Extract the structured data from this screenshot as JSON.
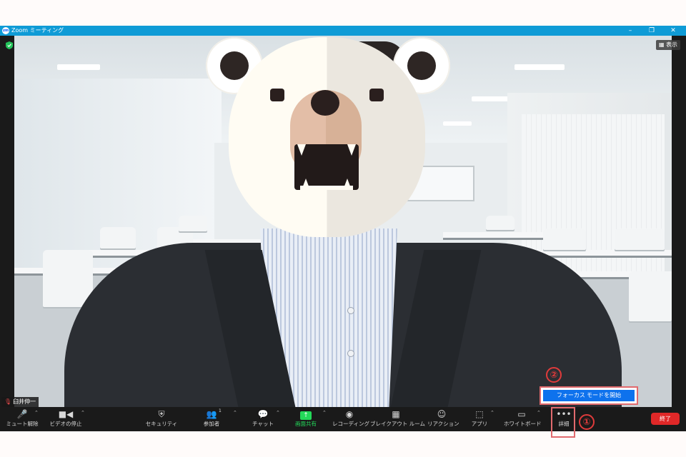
{
  "window": {
    "title": "Zoom ミーティング",
    "logo": "zoom",
    "controls": [
      "–",
      "❐",
      "✕"
    ]
  },
  "video": {
    "view_button": "表示",
    "participant_name": "臼井伸一",
    "participant_muted": true
  },
  "focus_popup": {
    "button_label": "フォーカス モードを開始"
  },
  "toolbar": {
    "mute_label": "ミュート解除",
    "video_label": "ビデオの停止",
    "security_label": "セキュリティ",
    "participants_label": "参加者",
    "participants_count": "1",
    "chat_label": "チャット",
    "share_label": "画面共有",
    "recording_label": "レコーディング",
    "breakout_label": "ブレイクアウト ルーム",
    "reactions_label": "リアクション",
    "apps_label": "アプリ",
    "whiteboard_label": "ホワイトボード",
    "more_label": "詳細",
    "end_label": "終了"
  },
  "annotations": {
    "step1": "①",
    "step2": "②",
    "color": "#e03b3b"
  },
  "colors": {
    "titlebar": "#0f9bd6",
    "share_green": "#23d959",
    "focus_blue": "#0e72ed",
    "end_red": "#e02828"
  }
}
